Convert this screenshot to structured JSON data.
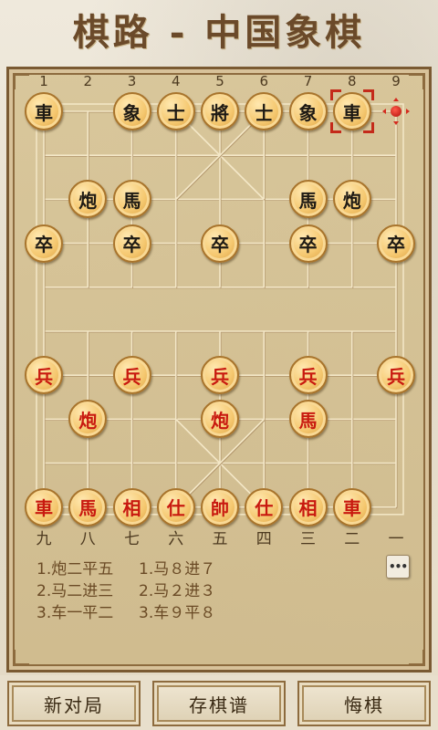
{
  "title": "棋路 - 中国象棋",
  "board": {
    "top_labels": [
      "1",
      "2",
      "3",
      "4",
      "5",
      "6",
      "7",
      "8",
      "9"
    ],
    "bottom_labels": [
      "九",
      "八",
      "七",
      "六",
      "五",
      "四",
      "三",
      "二",
      "一"
    ],
    "pieces": [
      {
        "char": "車",
        "color": "black",
        "col": 0,
        "row": 0
      },
      {
        "char": "象",
        "color": "black",
        "col": 2,
        "row": 0
      },
      {
        "char": "士",
        "color": "black",
        "col": 3,
        "row": 0
      },
      {
        "char": "將",
        "color": "black",
        "col": 4,
        "row": 0
      },
      {
        "char": "士",
        "color": "black",
        "col": 5,
        "row": 0
      },
      {
        "char": "象",
        "color": "black",
        "col": 6,
        "row": 0
      },
      {
        "char": "車",
        "color": "black",
        "col": 7,
        "row": 0
      },
      {
        "char": "炮",
        "color": "black",
        "col": 1,
        "row": 2
      },
      {
        "char": "馬",
        "color": "black",
        "col": 2,
        "row": 2
      },
      {
        "char": "馬",
        "color": "black",
        "col": 6,
        "row": 2
      },
      {
        "char": "炮",
        "color": "black",
        "col": 7,
        "row": 2
      },
      {
        "char": "卒",
        "color": "black",
        "col": 0,
        "row": 3
      },
      {
        "char": "卒",
        "color": "black",
        "col": 2,
        "row": 3
      },
      {
        "char": "卒",
        "color": "black",
        "col": 4,
        "row": 3
      },
      {
        "char": "卒",
        "color": "black",
        "col": 6,
        "row": 3
      },
      {
        "char": "卒",
        "color": "black",
        "col": 8,
        "row": 3
      },
      {
        "char": "兵",
        "color": "red",
        "col": 0,
        "row": 6
      },
      {
        "char": "兵",
        "color": "red",
        "col": 2,
        "row": 6
      },
      {
        "char": "兵",
        "color": "red",
        "col": 4,
        "row": 6
      },
      {
        "char": "兵",
        "color": "red",
        "col": 6,
        "row": 6
      },
      {
        "char": "兵",
        "color": "red",
        "col": 8,
        "row": 6
      },
      {
        "char": "炮",
        "color": "red",
        "col": 1,
        "row": 7
      },
      {
        "char": "炮",
        "color": "red",
        "col": 4,
        "row": 7
      },
      {
        "char": "馬",
        "color": "red",
        "col": 6,
        "row": 7
      },
      {
        "char": "車",
        "color": "red",
        "col": 0,
        "row": 9
      },
      {
        "char": "馬",
        "color": "red",
        "col": 1,
        "row": 9
      },
      {
        "char": "相",
        "color": "red",
        "col": 2,
        "row": 9
      },
      {
        "char": "仕",
        "color": "red",
        "col": 3,
        "row": 9
      },
      {
        "char": "帥",
        "color": "red",
        "col": 4,
        "row": 9
      },
      {
        "char": "仕",
        "color": "red",
        "col": 5,
        "row": 9
      },
      {
        "char": "相",
        "color": "red",
        "col": 6,
        "row": 9
      },
      {
        "char": "車",
        "color": "red",
        "col": 7,
        "row": 9
      }
    ],
    "selected": {
      "col": 7,
      "row": 0
    },
    "target": {
      "col": 8,
      "row": 0
    }
  },
  "moves": [
    {
      "a": "1.炮二平五",
      "b": "1.马８进７"
    },
    {
      "a": "2.马二进三",
      "b": "2.马２进３"
    },
    {
      "a": "3.车一平二",
      "b": "3.车９平８"
    }
  ],
  "more_label": "•••",
  "buttons": {
    "new_game": "新对局",
    "save_record": "存棋谱",
    "undo": "悔棋"
  }
}
